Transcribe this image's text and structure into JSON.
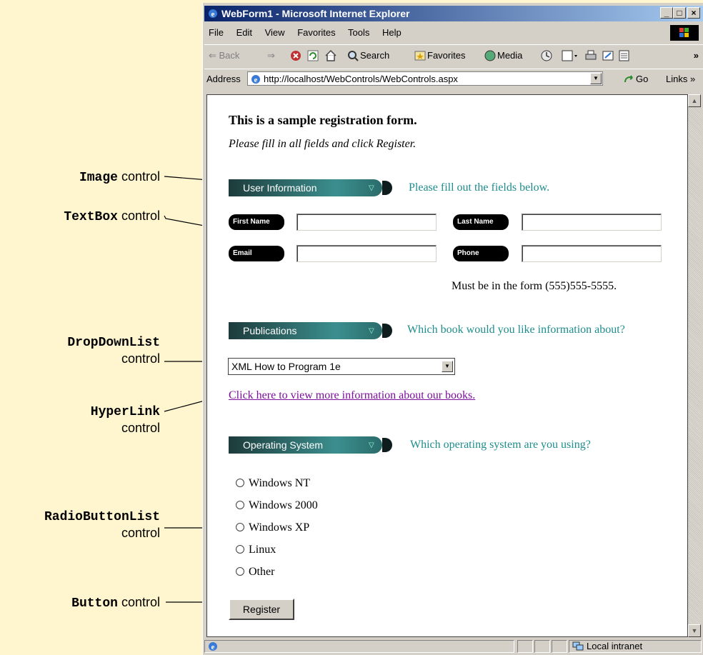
{
  "callouts": {
    "image": {
      "code": "Image",
      "text": "control"
    },
    "textbox": {
      "code": "TextBox",
      "text": "control"
    },
    "dropdown": {
      "code": "DropDownList",
      "text": "control"
    },
    "hyperlink": {
      "code": "HyperLink",
      "text": "control"
    },
    "radio": {
      "code": "RadioButtonList",
      "text": "control"
    },
    "button": {
      "code": "Button",
      "text": "control"
    }
  },
  "window": {
    "title": "WebForm1 - Microsoft Internet Explorer",
    "buttons": [
      "_",
      "□",
      "×"
    ]
  },
  "menu": [
    "File",
    "Edit",
    "View",
    "Favorites",
    "Tools",
    "Help"
  ],
  "toolbar": {
    "back": "⇐ Back",
    "forward": "⇒",
    "search": "Search",
    "favorites": "Favorites",
    "media": "Media",
    "more": "»"
  },
  "address": {
    "label": "Address",
    "url": "http://localhost/WebControls/WebControls.aspx",
    "go": "Go",
    "links": "Links »"
  },
  "page": {
    "heading": "This is a sample registration form.",
    "instructions": "Please fill in all fields and click Register.",
    "user_banner": "User Information",
    "user_hint": "Please fill out the fields below.",
    "first_name": "First Name",
    "last_name": "Last Name",
    "email": "Email",
    "phone": "Phone",
    "phone_hint": "Must be in the form (555)555-5555.",
    "pub_banner": "Publications",
    "pub_hint": "Which book would you like information about?",
    "selected_book": "XML How to Program 1e",
    "link_text": "Click here to view more information about our books.",
    "os_banner": "Operating System",
    "os_hint": "Which operating system are you using?",
    "os_options": [
      "Windows NT",
      "Windows 2000",
      "Windows XP",
      "Linux",
      "Other"
    ],
    "register": "Register"
  },
  "status": {
    "zone": "Local intranet"
  },
  "colors": {
    "accent_teal": "#1e8c8c",
    "link": "#7b0f9c",
    "background": "#fff5cf"
  }
}
